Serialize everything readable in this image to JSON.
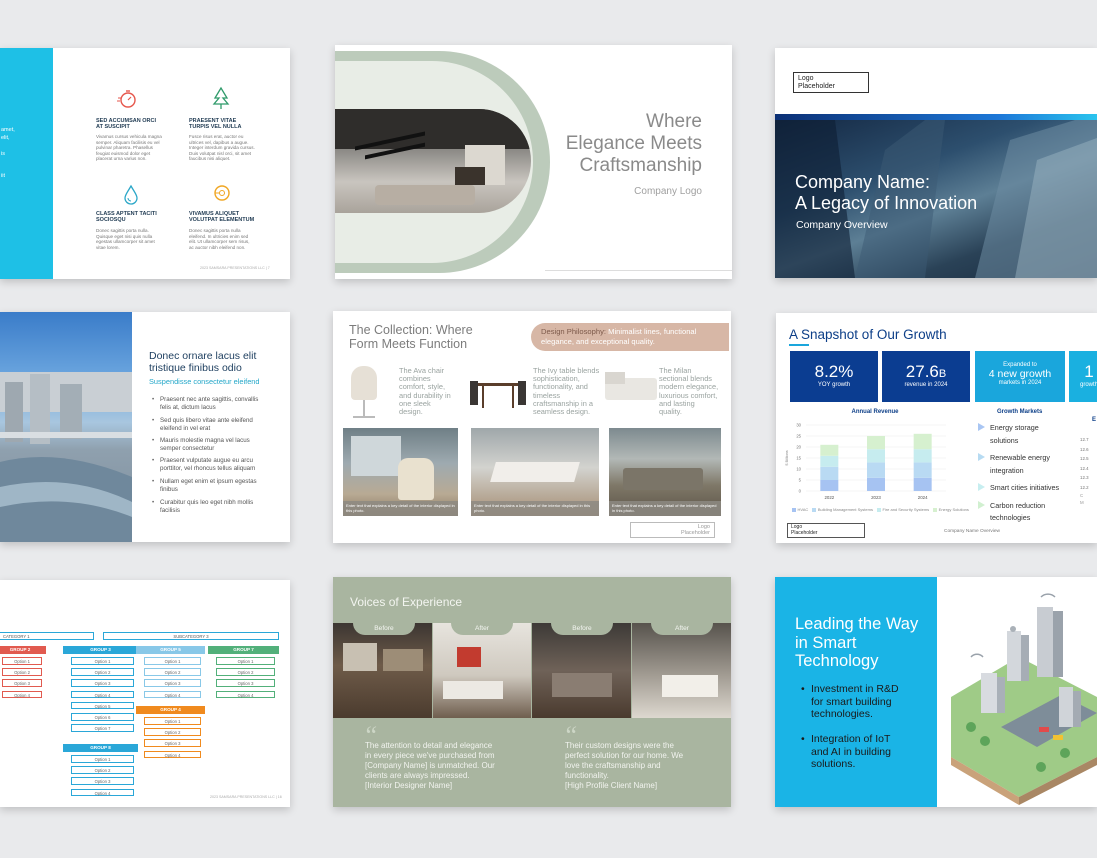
{
  "s1": {
    "side_text": [
      "amet,",
      "elit,",
      "is",
      "iit"
    ],
    "features": [
      {
        "icon": "stopwatch-icon",
        "title": "SED ACCUMSAN ORCI AT SUSCIPIT",
        "body": "Vivamus cursus vehicula magna semper. Aliquam facilisis eu vel pulvinar pharetra. Phasellus feugiat euismod dolor eget placerat urna varius non."
      },
      {
        "icon": "tree-icon",
        "title": "PRAESENT VITAE TURPIS VEL NULLA",
        "body": "Fusce risus erat, auctor eu ultrices vel, dapibus a augue. Integer interdum gravida cursus. Duis volutpat nisl orci, sit amet faucibus nisi aliquet."
      },
      {
        "icon": "drop-icon",
        "title": "CLASS APTENT TACITI SOCIOSQU",
        "body": "Donec sagittis porta nulla. Quisque eget nisi quis nulla egestas ullamcorper sit amet vitae lorem."
      },
      {
        "icon": "sun-icon",
        "title": "VIVAMUS ALIQUET VOLUTPAT ELEMENTUM",
        "body": "Donec sagittis porta nulla eleifend. In ultricies enim sed elit. Ut ullamcorper sem risus, ac auctor nibh eleifend non."
      }
    ],
    "footer": "2023 SAMSARA PRESENTATIONS LLC | 7"
  },
  "s2": {
    "title_lines": [
      "Where",
      "Elegance Meets",
      "Craftsmanship"
    ],
    "logo": "Company Logo"
  },
  "s3": {
    "logo_lines": [
      "Logo",
      "Placeholder"
    ],
    "title_lines": [
      "Company Name:",
      "A Legacy of Innovation"
    ],
    "subtitle": "Company Overview"
  },
  "s5": {
    "title_lines": [
      "Donec ornare lacus elit",
      "tristique finibus odio"
    ],
    "subtitle": "Suspendisse consectetur eleifend",
    "bullets": [
      [
        "Praesent nec ante sagittis, convallis",
        "felis at, dictum lacus"
      ],
      [
        "Sed quis libero vitae ante eleifend",
        "eleifend in vel erat"
      ],
      [
        "Mauris molestie magna vel lacus",
        "semper consectetur"
      ],
      [
        "Praesent vulputate augue eu arcu",
        "porttitor, vel rhoncus tellus aliquam"
      ],
      [
        "Nullam eget enim et ipsum egestas",
        "finibus"
      ],
      [
        "Curabitur quis leo eget nibh mollis",
        "facilisis"
      ]
    ]
  },
  "s6": {
    "title_lines": [
      "The Collection: Where",
      "Form Meets Function"
    ],
    "philosophy_label": "Design Philosophy:",
    "philosophy_lines": [
      "Minimalist lines, functional",
      "elegance, and exceptional quality."
    ],
    "items": [
      {
        "lines": [
          "The Ava chair",
          "combines",
          "comfort, style,",
          "and durability in",
          "one sleek",
          "design."
        ]
      },
      {
        "lines": [
          "The Ivy table blends",
          "sophistication,",
          "functionality, and",
          "timeless",
          "craftsmanship in a",
          "seamless design."
        ]
      },
      {
        "lines": [
          "The Milan",
          "sectional blends",
          "modern elegance,",
          "luxurious comfort,",
          "and lasting",
          "quality."
        ]
      }
    ],
    "photo_caption": "Enter text that explains a key detail of the interior displayed in this photo.",
    "logo_lines": [
      "Logo",
      "Placeholder"
    ]
  },
  "s7": {
    "title": "A Snapshot of Our Growth",
    "kpis": [
      {
        "big": "8.2%",
        "small": "YOY growth",
        "color": "#0b3d91"
      },
      {
        "big": "27.6",
        "unit": "B",
        "small": "revenue in 2024",
        "color": "#0b3d91"
      },
      {
        "pre": "Expanded to",
        "big": "4 new growth",
        "small": "markets in 2024",
        "color": "#1aa6dc"
      },
      {
        "big": "1",
        "small": "growth",
        "color": "#1ab0e0"
      }
    ],
    "growth_markets_title": "Growth Markets",
    "growth_markets": [
      {
        "lines": [
          "Energy storage",
          "solutions"
        ],
        "color": "#a9c6f3"
      },
      {
        "lines": [
          "Renewable energy",
          "integration"
        ],
        "color": "#b7dbf2"
      },
      {
        "lines": [
          "Smart cities initiatives"
        ],
        "color": "#c7eef0"
      },
      {
        "lines": [
          "Carbon reduction",
          "technologies"
        ],
        "color": "#d1f0d0"
      }
    ],
    "third_title": "E",
    "third_ticks": [
      "12.7",
      "12.6",
      "12.5",
      "12.4",
      "12.3",
      "12.2"
    ],
    "third_legend": [
      "C",
      "M"
    ],
    "logo_lines": [
      "Logo",
      "Placeholder"
    ],
    "footer": "Company Name Overview"
  },
  "chart_data": {
    "type": "bar",
    "title": "Annual Revenue",
    "ylabel": "$ Billions",
    "categories": [
      "2022",
      "2023",
      "2024"
    ],
    "stacked": true,
    "ylim": [
      0,
      30
    ],
    "yticks": [
      "30",
      "25",
      "20",
      "15",
      "10",
      "5",
      "0"
    ],
    "series": [
      {
        "name": "HVAC",
        "values": [
          5,
          6,
          6
        ],
        "color": "#a6c3f2"
      },
      {
        "name": "Building Management Systems",
        "values": [
          6,
          7,
          7
        ],
        "color": "#b9daf3"
      },
      {
        "name": "Fire and Security Systems",
        "values": [
          5,
          6,
          6
        ],
        "color": "#c6ecef"
      },
      {
        "name": "Energy Solutions",
        "values": [
          5,
          6,
          7
        ],
        "color": "#d6f0cf"
      }
    ]
  },
  "s8": {
    "cat_left": "CATEGORY 1",
    "cat_right": "SUBCATEGORY 3",
    "groups": [
      {
        "name": "GROUP 2",
        "color": "#e15a4f",
        "options": [
          "Option 1",
          "Option 2",
          "Option 3",
          "Option 4"
        ]
      },
      {
        "name": "GROUP 3",
        "color": "#2aa7d8",
        "options": [
          "Option 1",
          "Option 2",
          "Option 3",
          "Option 4",
          "Option 5",
          "Option 6",
          "Option 7"
        ]
      },
      {
        "name": "GROUP 5",
        "color": "#88c8e8",
        "options": [
          "Option 1",
          "Option 2",
          "Option 3",
          "Option 4"
        ]
      },
      {
        "name": "GROUP 7",
        "color": "#52b07a",
        "options": [
          "Option 1",
          "Option 2",
          "Option 3",
          "Option 4"
        ]
      },
      {
        "name": "GROUP 4",
        "color": "#f08a1e",
        "options": [
          "Option 1",
          "Option 2",
          "Option 3",
          "Option 4"
        ]
      },
      {
        "name": "GROUP 8",
        "color": "#2aa7d8",
        "options": [
          "Option 1",
          "Option 2",
          "Option 3",
          "Option 4"
        ]
      }
    ],
    "footer": "2023 SAMSARA PRESENTATIONS LLC | 16"
  },
  "s9": {
    "title": "Voices of Experience",
    "tabs": [
      "Before",
      "After",
      "Before",
      "After"
    ],
    "quotes": [
      {
        "lines": [
          "The attention to detail and elegance",
          "in every piece we've purchased from",
          "[Company Name] is unmatched. Our",
          "clients are always impressed.",
          "[Interior Designer Name]"
        ]
      },
      {
        "lines": [
          "Their custom designs were the",
          "perfect solution for our home. We",
          "love the craftsmanship and",
          "functionality.",
          "[High Profile Client Name]"
        ]
      }
    ]
  },
  "s10": {
    "title_lines": [
      "Leading the Way",
      "in Smart",
      "Technology"
    ],
    "bullets": [
      [
        "Investment in R&D",
        "for smart building",
        "technologies."
      ],
      [
        "Integration of IoT",
        "and AI in building",
        "solutions."
      ]
    ]
  }
}
